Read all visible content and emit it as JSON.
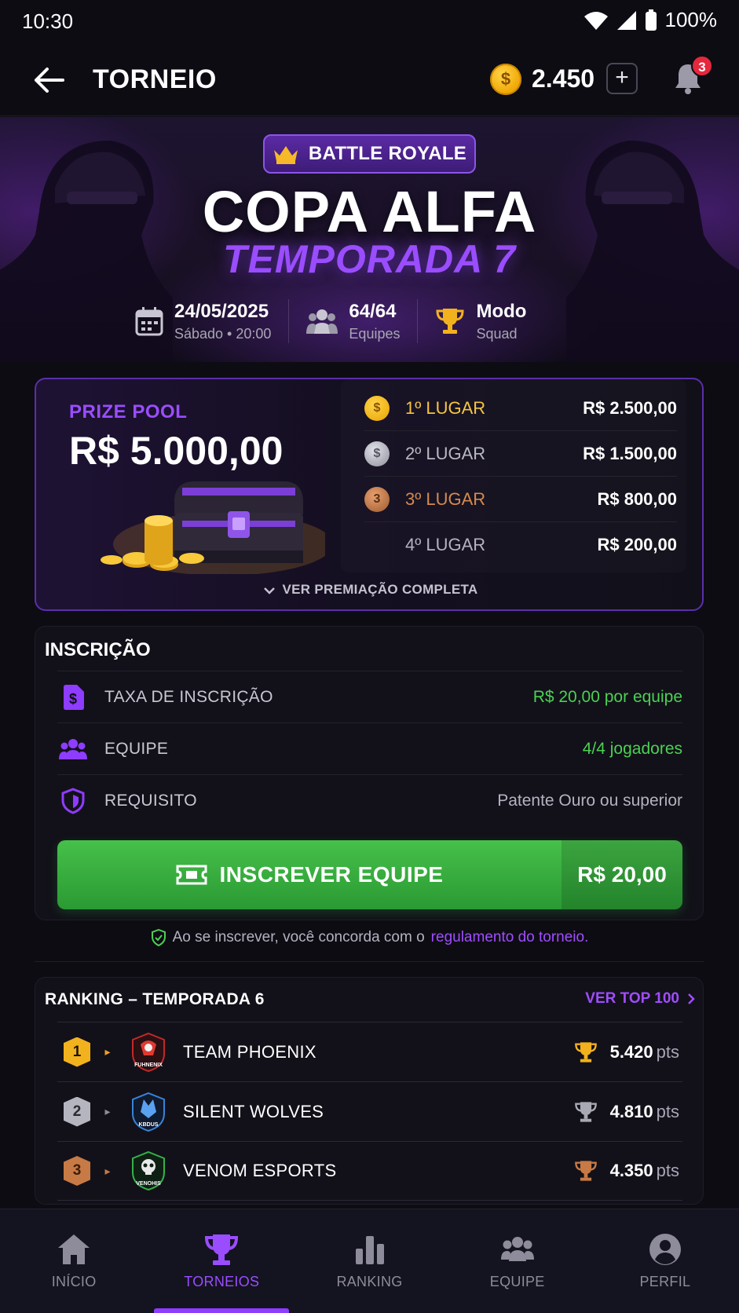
{
  "status": {
    "time": "10:30",
    "battery": "100%"
  },
  "header": {
    "title": "TORNEIO",
    "coin_balance": "2.450",
    "add_label": "+",
    "notifications_count": "3"
  },
  "hero": {
    "badge": "BATTLE ROYALE",
    "title": "COPA ALFA",
    "subtitle": "TEMPORADA 7",
    "info": [
      {
        "main": "24/05/2025",
        "sub": "Sábado • 20:00",
        "icon": "calendar-icon"
      },
      {
        "main": "64/64",
        "sub": "Equipes",
        "icon": "users-icon"
      },
      {
        "main": "Modo",
        "sub": "Squad",
        "icon": "trophy-icon"
      }
    ]
  },
  "prize": {
    "label": "PRIZE POOL",
    "amount": "R$ 5.000,00",
    "see_all": "VER PREMIAÇÃO COMPLETA",
    "places": [
      {
        "medal": "$",
        "name": "1º LUGAR",
        "prize": "R$ 2.500,00",
        "color": "#f5c542"
      },
      {
        "medal": "$",
        "name": "2º LUGAR",
        "prize": "R$ 1.500,00",
        "color": "#b8b8c2"
      },
      {
        "medal": "3",
        "name": "3º LUGAR",
        "prize": "R$ 800,00",
        "color": "#d48a4e"
      },
      {
        "medal": "",
        "name": "4º LUGAR",
        "prize": "R$ 200,00",
        "color": "#b5b2c0"
      }
    ]
  },
  "inscription": {
    "title": "INSCRIÇÃO",
    "rows": [
      {
        "label": "TAXA DE INSCRIÇÃO",
        "value": "R$ 20,00 por equipe",
        "icon": "price-tag-icon"
      },
      {
        "label": "EQUIPE",
        "value": "4/4 jogadores",
        "icon": "team-icon"
      },
      {
        "label": "REQUISITO",
        "value": "Patente Ouro ou superior",
        "icon": "shield-icon"
      }
    ],
    "cta_label": "INSCREVER EQUIPE",
    "cta_price": "R$ 20,00",
    "terms_text": "Ao se inscrever, você concorda com o",
    "terms_link": "regulamento do torneio."
  },
  "ranking": {
    "title": "RANKING – TEMPORADA 6",
    "link": "VER TOP 100",
    "teams": [
      {
        "pos": "1",
        "name": "TEAM PHOENIX",
        "points": "5.420",
        "unit": "pts",
        "logo_text": "FUHNENIX",
        "pos_color": "#f2b21e",
        "trend_color": "#f2a21e"
      },
      {
        "pos": "2",
        "name": "SILENT WOLVES",
        "points": "4.810",
        "unit": "pts",
        "logo_text": "KBDUS",
        "pos_color": "#b5b5bf",
        "trend_color": "#8e8b9a"
      },
      {
        "pos": "3",
        "name": "VENOM ESPORTS",
        "points": "4.350",
        "unit": "pts",
        "logo_text": "VENOHIS",
        "pos_color": "#c77a45",
        "trend_color": "#c77a45"
      }
    ]
  },
  "nav": [
    {
      "label": "INÍCIO",
      "icon": "home-icon"
    },
    {
      "label": "TORNEIOS",
      "icon": "trophy-icon"
    },
    {
      "label": "RANKING",
      "icon": "bar-chart-icon"
    },
    {
      "label": "EQUIPE",
      "icon": "team-icon"
    },
    {
      "label": "PERFIL",
      "icon": "profile-icon"
    }
  ]
}
